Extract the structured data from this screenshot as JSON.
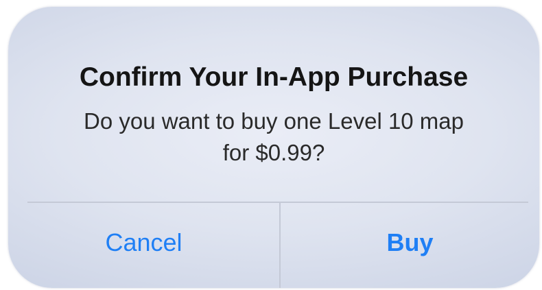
{
  "dialog": {
    "title": "Confirm Your In-App Purchase",
    "message_line1": "Do you want to buy one Level 10 map",
    "message_line2": "for $0.99?",
    "cancel_label": "Cancel",
    "buy_label": "Buy"
  },
  "colors": {
    "button_text": "#1f7ff5",
    "title_text": "#151515",
    "divider": "#c4c9d6"
  }
}
